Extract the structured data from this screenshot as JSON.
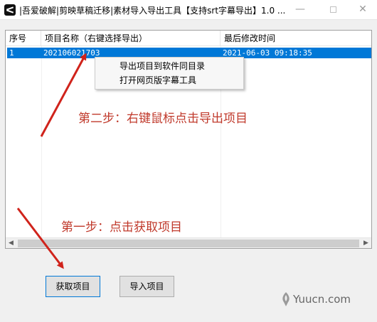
{
  "window": {
    "title": "|吾爱破解|剪映草稿迁移|素材导入导出工具【支持srt字幕导出】1.0 ...",
    "minimize_glyph": "—",
    "close_glyph": "✕"
  },
  "table": {
    "columns": [
      "序号",
      "项目名称（右键选择导出）",
      "最后修改时间"
    ],
    "rows": [
      {
        "index": "1",
        "name": "202106021703",
        "modified": "2021-06-03 09:18:35"
      }
    ]
  },
  "context_menu": {
    "items": [
      "导出项目到软件同目录",
      "打开网页版字幕工具"
    ]
  },
  "annotations": {
    "step2": "第二步：右键鼠标点击导出项目",
    "step1": "第一步：点击获取项目",
    "color": "#c0392b"
  },
  "buttons": {
    "fetch": "获取项目",
    "import": "导入项目"
  },
  "scrollbar": {
    "left_glyph": "◀",
    "right_glyph": "▶"
  },
  "watermark": {
    "text": "Yuucn.com"
  },
  "colors": {
    "selection": "#0078d7",
    "annotation": "#c0392b"
  }
}
